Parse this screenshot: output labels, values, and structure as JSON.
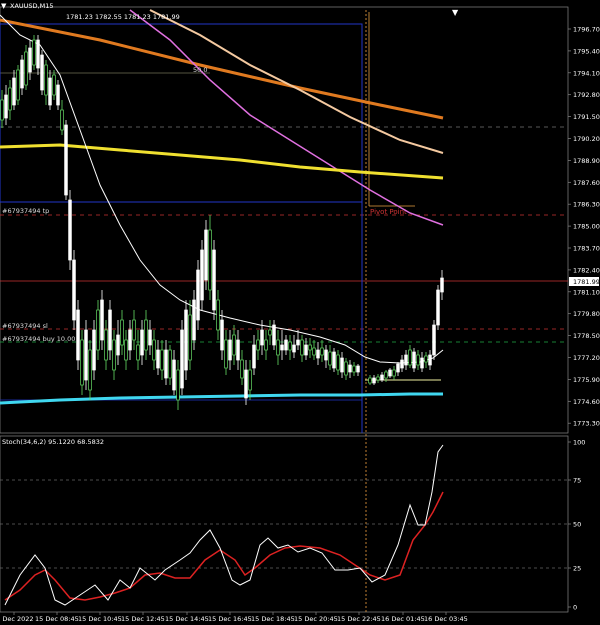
{
  "header": {
    "symbol": "XAUUSD,M15",
    "ohlc": "1781.23 1782.55 1781.23 1781.99",
    "ma_label": "50.0",
    "menu_icon": "triangle-down-icon"
  },
  "price_axis": {
    "ticks": [
      "1796.70",
      "1795.40",
      "1794.10",
      "1792.80",
      "1791.50",
      "1790.20",
      "1788.90",
      "1787.60",
      "1786.30",
      "1785.00",
      "1783.70",
      "1782.40",
      "1781.10",
      "1779.80",
      "1778.50",
      "1777.20",
      "1775.90",
      "1774.60",
      "1773.30"
    ],
    "current_price": "1781.99"
  },
  "order_labels": {
    "tp": "#67937494 tp",
    "sl": "#67937494 sl",
    "buy": "#67937494 buy 10.00"
  },
  "pivot_label": "Pivot Point",
  "stoch": {
    "header": "Stoch(34,6,2) 95.1220 68.5832",
    "ticks": [
      "100",
      "75",
      "50",
      "25",
      "0"
    ]
  },
  "time_axis": {
    "labels": [
      "15 Dec 2022",
      "15 Dec 08:45",
      "15 Dec 10:45",
      "15 Dec 12:45",
      "15 Dec 14:45",
      "15 Dec 16:45",
      "15 Dec 18:45",
      "15 Dec 20:45",
      "15 Dec 22:45",
      "16 Dec 01:45",
      "16 Dec 03:45"
    ]
  },
  "colors": {
    "background": "#000000",
    "bull": "#66dd66",
    "bear": "#ffffff",
    "ma_white": "#ffffff",
    "ma_orange": "#e07a20",
    "ma_peach": "#f4c9a0",
    "ma_violet": "#e070e0",
    "ma_yellow": "#f0e030",
    "ma_cyan": "#40d8f0",
    "tp_line": "#cc3333",
    "entry_line": "#22aa44",
    "stoch_main": "#ffffff",
    "stoch_signal": "#dd2222"
  }
}
